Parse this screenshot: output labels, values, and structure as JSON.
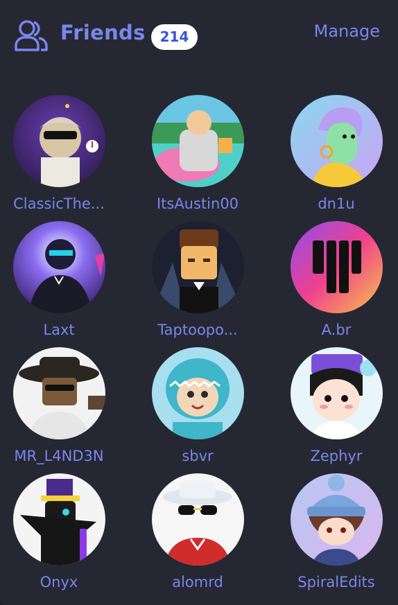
{
  "header": {
    "icon": "friends-icon",
    "title": "Friends",
    "count": "214",
    "manage_label": "Manage"
  },
  "colors": {
    "panel_bg": "#252832",
    "accent": "#7a86ec",
    "badge_bg": "#ffffff",
    "badge_text": "#3a55d8"
  },
  "friends": [
    {
      "name": "ClassicThe..."
    },
    {
      "name": "ItsAustin00"
    },
    {
      "name": "dn1u"
    },
    {
      "name": "Laxt"
    },
    {
      "name": "Taptoopo..."
    },
    {
      "name": "A.br"
    },
    {
      "name": "MR_L4ND3N"
    },
    {
      "name": "sbvr"
    },
    {
      "name": "Zephyr"
    },
    {
      "name": "Onyx"
    },
    {
      "name": "alomrd"
    },
    {
      "name": "SpiralEdits"
    }
  ]
}
